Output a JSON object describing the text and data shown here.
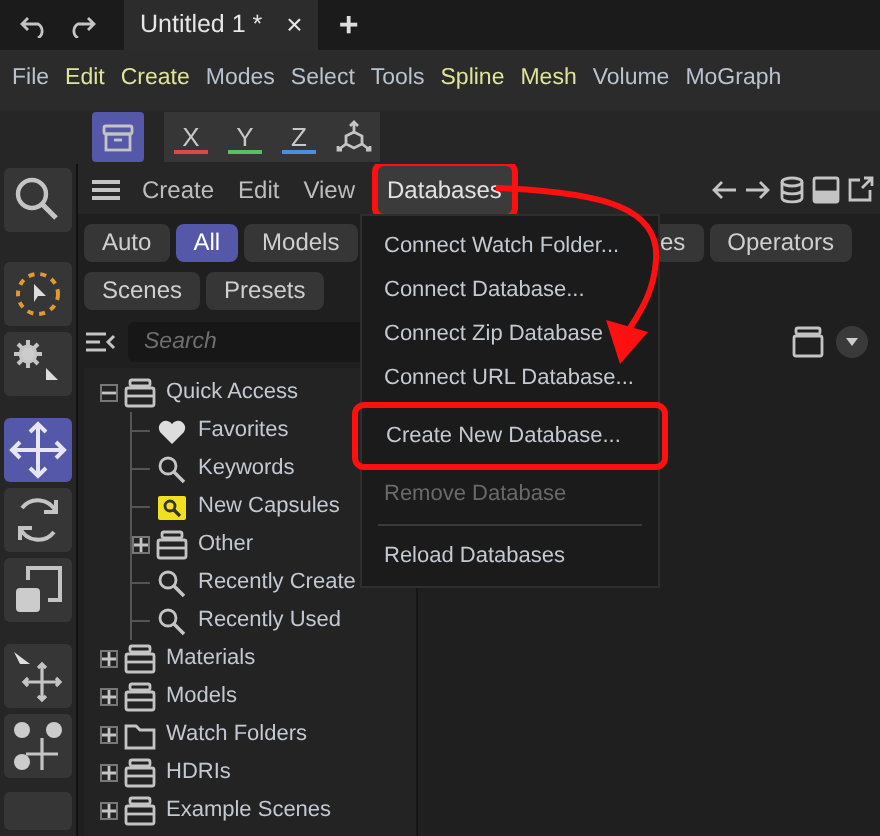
{
  "title_bar": {
    "tabs": [
      {
        "label": "Untitled 1 *",
        "selected": true,
        "close": "×"
      }
    ],
    "add_tab": "+"
  },
  "menu_bar": [
    {
      "label": "File",
      "color": "#b8c3d0"
    },
    {
      "label": "Edit",
      "color": "#dfe39b"
    },
    {
      "label": "Create",
      "color": "#dfe39b"
    },
    {
      "label": "Modes",
      "color": "#b8c3d0"
    },
    {
      "label": "Select",
      "color": "#b8c3d0"
    },
    {
      "label": "Tools",
      "color": "#b8c3d0"
    },
    {
      "label": "Spline",
      "color": "#dfe39b"
    },
    {
      "label": "Mesh",
      "color": "#dfe39b"
    },
    {
      "label": "Volume",
      "color": "#b8c3d0"
    },
    {
      "label": "MoGraph",
      "color": "#b8c3d0"
    }
  ],
  "axis_buttons": [
    {
      "label": "X",
      "color": "#e04848"
    },
    {
      "label": "Y",
      "color": "#58c060"
    },
    {
      "label": "Z",
      "color": "#4a8ee0"
    }
  ],
  "tools": [
    {
      "kind": "search",
      "selected": false
    },
    {
      "kind": "live-select",
      "selected": false
    },
    {
      "kind": "gear-pointer",
      "selected": false
    },
    {
      "kind": "move",
      "selected": true
    },
    {
      "kind": "rotate",
      "selected": false
    },
    {
      "kind": "scale",
      "selected": false
    },
    {
      "kind": "pointer-move",
      "selected": false
    },
    {
      "kind": "spheres-move",
      "selected": false
    },
    {
      "kind": "partial",
      "selected": false
    }
  ],
  "panel": {
    "menu": [
      {
        "label": "Create",
        "open": false,
        "boxed": false
      },
      {
        "label": "Edit",
        "open": false,
        "boxed": false
      },
      {
        "label": "View",
        "open": false,
        "boxed": false
      },
      {
        "label": "Databases",
        "open": true,
        "boxed": true
      }
    ],
    "filters": [
      {
        "label": "Auto",
        "selected": false
      },
      {
        "label": "All",
        "selected": true
      },
      {
        "label": "Models",
        "selected": false
      },
      {
        "label": "es",
        "selected": false
      },
      {
        "label": "Operators",
        "selected": false
      },
      {
        "label": "Scenes",
        "selected": false
      },
      {
        "label": "Presets",
        "selected": false
      }
    ],
    "search": {
      "placeholder": "Search"
    },
    "tree": [
      {
        "label": "Quick Access",
        "kind": "database",
        "expanded": true,
        "children": [
          {
            "label": "Favorites",
            "kind": "heart"
          },
          {
            "label": "Keywords",
            "kind": "search"
          },
          {
            "label": "New Capsules",
            "kind": "capsule"
          },
          {
            "label": "Other",
            "kind": "database",
            "expanded": false
          },
          {
            "label": "Recently Create",
            "kind": "search"
          },
          {
            "label": "Recently Used",
            "kind": "search"
          }
        ]
      },
      {
        "label": "Materials",
        "kind": "database",
        "expanded": false
      },
      {
        "label": "Models",
        "kind": "database",
        "expanded": false
      },
      {
        "label": "Watch Folders",
        "kind": "folder",
        "expanded": false
      },
      {
        "label": "HDRIs",
        "kind": "database",
        "expanded": false
      },
      {
        "label": "Example Scenes",
        "kind": "database",
        "expanded": false
      }
    ]
  },
  "dropdown": [
    {
      "label": "Connect Watch Folder...",
      "kind": "item",
      "disabled": false,
      "boxed": false
    },
    {
      "label": "Connect Database...",
      "kind": "item",
      "disabled": false,
      "boxed": false
    },
    {
      "label": "Connect Zip Database",
      "kind": "item",
      "disabled": false,
      "boxed": false
    },
    {
      "label": "Connect URL Database...",
      "kind": "item",
      "disabled": false,
      "boxed": false
    },
    {
      "label": "Create New Database...",
      "kind": "item",
      "disabled": false,
      "boxed": true
    },
    {
      "label": "Remove Database",
      "kind": "item",
      "disabled": true,
      "boxed": false
    },
    {
      "kind": "separator"
    },
    {
      "label": "Reload Databases",
      "kind": "item",
      "disabled": false,
      "boxed": false
    }
  ]
}
